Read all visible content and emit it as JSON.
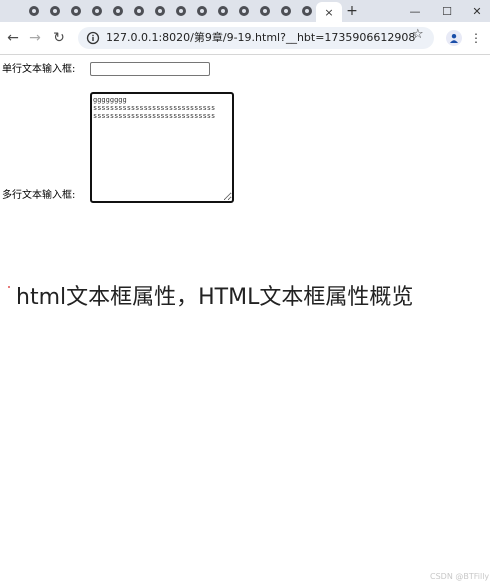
{
  "browser": {
    "url": "127.0.0.1:8020/第9章/9-19.html?__hbt=1735906612908",
    "active_tab_close": "×",
    "new_tab": "+",
    "window_controls": {
      "minimize": "—",
      "maximize": "☐",
      "close": "✕"
    }
  },
  "page": {
    "single_line_label": "单行文本输入框:",
    "single_line_value": "",
    "multi_line_label": "多行文本输入框:",
    "multi_line_value": "gggggggg\nsssssssssssssssssssssssssssss\nsssssssssssssssssssssssssssss"
  },
  "overlay": {
    "caption": "html文本框属性，HTML文本框属性概览",
    "watermark": "CSDN @BTFilly"
  },
  "colors": {
    "tabstrip": "#dfe3eb",
    "omnibox": "#edf1f7",
    "spellcheck_underline": "#e05050"
  }
}
